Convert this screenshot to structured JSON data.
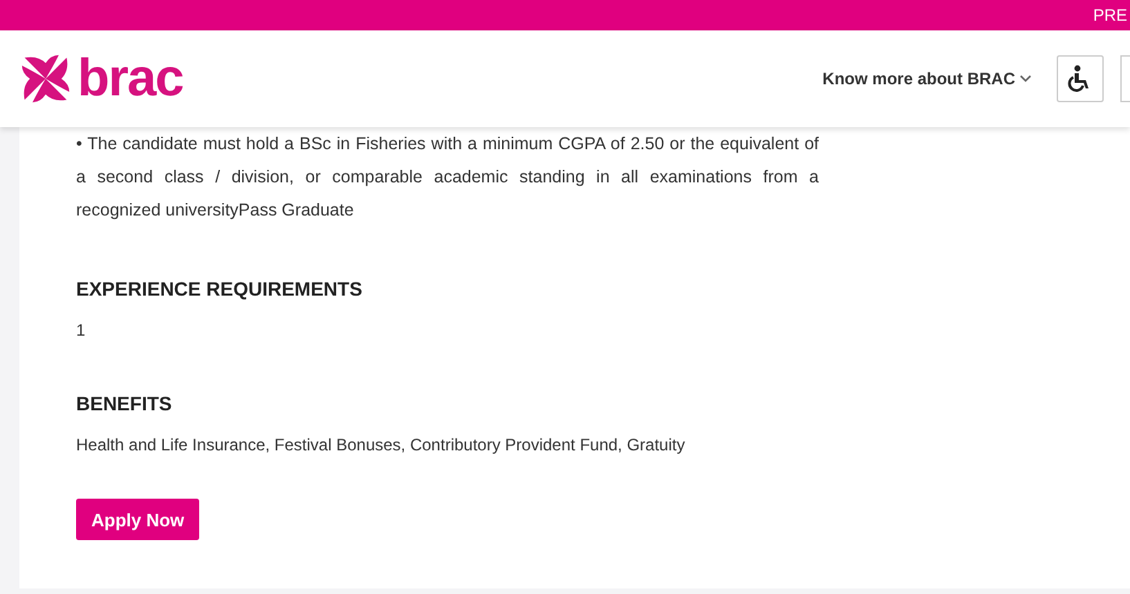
{
  "top_bar": {
    "text": "PRE"
  },
  "header": {
    "logo_text": "brac",
    "nav_link": "Know more about BRAC"
  },
  "content": {
    "paragraph": "• The candidate must hold a BSc in Fisheries with a minimum CGPA of 2.50 or the equivalent of a second class / division, or comparable academic standing in all examinations from a recognized universityPass Graduate",
    "sections": [
      {
        "heading": "EXPERIENCE REQUIREMENTS",
        "body": "1"
      },
      {
        "heading": "BENEFITS",
        "body": "Health and Life Insurance, Festival Bonuses, Contributory Provident Fund, Gratuity"
      }
    ],
    "button": "Apply Now"
  }
}
